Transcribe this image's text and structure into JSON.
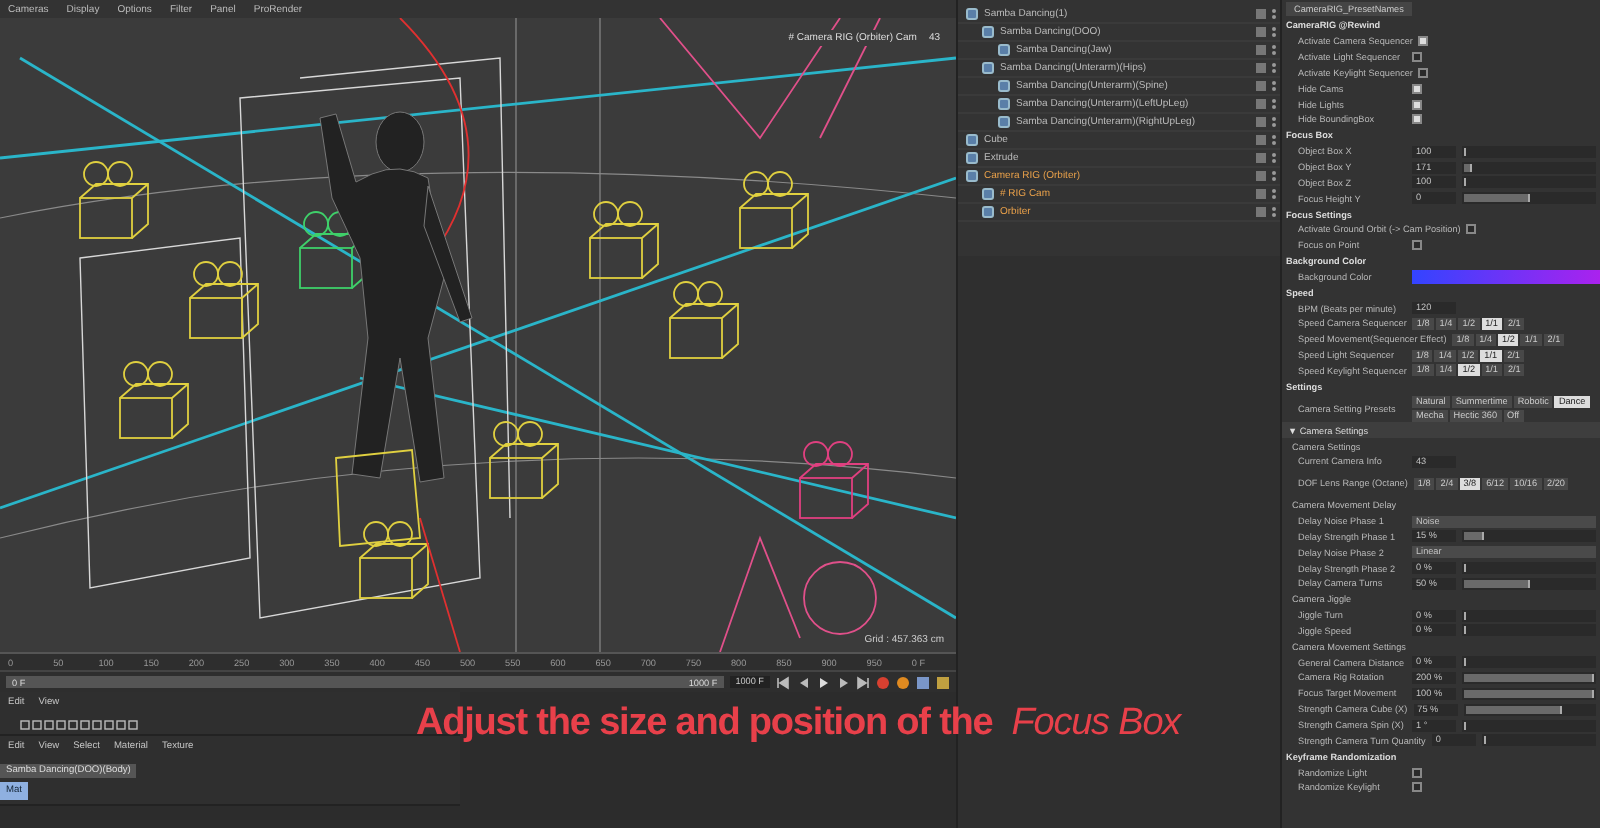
{
  "viewport": {
    "menu": [
      "Cameras",
      "Display",
      "Options",
      "Filter",
      "Panel",
      "ProRender"
    ],
    "camera_label": "# Camera RIG (Orbiter) Cam",
    "camera_number": "43",
    "grid_reading": "Grid : 457.363 cm"
  },
  "objects": [
    {
      "name": "Samba Dancing(1)",
      "selected": false,
      "children": [
        {
          "name": "Samba Dancing(DOO)",
          "selected": false,
          "children": [
            {
              "name": "Samba Dancing(Jaw)",
              "selected": false
            }
          ]
        },
        {
          "name": "Samba Dancing(Unterarm)(Hips)",
          "selected": false,
          "children": [
            {
              "name": "Samba Dancing(Unterarm)(Spine)",
              "selected": false
            },
            {
              "name": "Samba Dancing(Unterarm)(LeftUpLeg)",
              "selected": false
            },
            {
              "name": "Samba Dancing(Unterarm)(RightUpLeg)",
              "selected": false
            }
          ]
        }
      ]
    },
    {
      "name": "Cube",
      "selected": false
    },
    {
      "name": "Extrude",
      "selected": false
    },
    {
      "name": "Camera RIG (Orbiter)",
      "selected": true,
      "children": [
        {
          "name": "# RIG Cam",
          "selected": true
        },
        {
          "name": "Orbiter",
          "selected": true
        }
      ]
    }
  ],
  "attributes": {
    "tab": "CameraRIG_PresetNames",
    "rows": [
      {
        "kind": "header",
        "label": "CameraRIG @Rewind"
      },
      {
        "kind": "check",
        "label": "Activate Camera Sequencer",
        "checked": true
      },
      {
        "kind": "check",
        "label": "Activate Light Sequencer",
        "checked": false
      },
      {
        "kind": "check",
        "label": "Activate Keylight Sequencer",
        "checked": false
      },
      {
        "kind": "check",
        "label": "Hide Cams",
        "checked": true
      },
      {
        "kind": "check",
        "label": "Hide Lights",
        "checked": true
      },
      {
        "kind": "check",
        "label": "Hide BoundingBox",
        "checked": true
      },
      {
        "kind": "header",
        "label": "Focus Box"
      },
      {
        "kind": "number",
        "label": "Object Box X",
        "value": "100",
        "level": 0.02
      },
      {
        "kind": "number",
        "label": "Object Box Y",
        "value": "171",
        "level": 0.06
      },
      {
        "kind": "number",
        "label": "Object Box Z",
        "value": "100",
        "level": 0.02
      },
      {
        "kind": "number",
        "label": "Focus Height Y",
        "value": "0",
        "level": 0.5
      },
      {
        "kind": "header",
        "label": "Focus Settings"
      },
      {
        "kind": "check",
        "label": "Activate Ground Orbit (-> Cam Position)",
        "checked": false
      },
      {
        "kind": "check",
        "label": "Focus on Point",
        "checked": false
      },
      {
        "kind": "header",
        "label": "Background Color"
      },
      {
        "kind": "color",
        "label": "Background Color"
      },
      {
        "kind": "header",
        "label": "Speed"
      },
      {
        "kind": "value",
        "label": "BPM (Beats per minute)",
        "value": "120"
      },
      {
        "kind": "options",
        "label": "Speed Camera Sequencer",
        "options": [
          {
            "label": "1/8",
            "selected": false
          },
          {
            "label": "1/4",
            "selected": false
          },
          {
            "label": "1/2",
            "selected": false
          },
          {
            "label": "1/1",
            "selected": true
          },
          {
            "label": "2/1",
            "selected": false
          }
        ]
      },
      {
        "kind": "options",
        "label": "Speed Movement(Sequencer Effect)",
        "options": [
          {
            "label": "1/8",
            "selected": false
          },
          {
            "label": "1/4",
            "selected": false
          },
          {
            "label": "1/2",
            "selected": true
          },
          {
            "label": "1/1",
            "selected": false
          },
          {
            "label": "2/1",
            "selected": false
          }
        ]
      },
      {
        "kind": "options",
        "label": "Speed Light Sequencer",
        "options": [
          {
            "label": "1/8",
            "selected": false
          },
          {
            "label": "1/4",
            "selected": false
          },
          {
            "label": "1/2",
            "selected": false
          },
          {
            "label": "1/1",
            "selected": true
          },
          {
            "label": "2/1",
            "selected": false
          }
        ]
      },
      {
        "kind": "options",
        "label": "Speed Keylight Sequencer",
        "options": [
          {
            "label": "1/8",
            "selected": false
          },
          {
            "label": "1/4",
            "selected": false
          },
          {
            "label": "1/2",
            "selected": true
          },
          {
            "label": "1/1",
            "selected": false
          },
          {
            "label": "2/1",
            "selected": false
          }
        ]
      },
      {
        "kind": "header",
        "label": "Settings"
      },
      {
        "kind": "options",
        "label": "Camera Setting Presets",
        "options": [
          {
            "label": "Natural",
            "selected": false
          },
          {
            "label": "Summertime",
            "selected": false
          },
          {
            "label": "Robotic",
            "selected": false
          },
          {
            "label": "Dance",
            "selected": true
          },
          {
            "label": "Mecha",
            "selected": false
          },
          {
            "label": "Hectic 360",
            "selected": false
          },
          {
            "label": "Off",
            "selected": false
          }
        ]
      },
      {
        "kind": "group",
        "label": "▼ Camera Settings"
      },
      {
        "kind": "sub",
        "label": "Camera Settings"
      },
      {
        "kind": "value",
        "label": "Current Camera Info",
        "value": "43"
      },
      {
        "kind": "options",
        "label": "DOF Lens Range (Octane)",
        "options": [
          {
            "label": "1/8",
            "selected": false
          },
          {
            "label": "2/4",
            "selected": false
          },
          {
            "label": "3/8",
            "selected": true
          },
          {
            "label": "6/12",
            "selected": false
          },
          {
            "label": "10/16",
            "selected": false
          },
          {
            "label": "2/20",
            "selected": false
          }
        ]
      },
      {
        "kind": "sub",
        "label": "Camera Movement Delay"
      },
      {
        "kind": "choice",
        "label": "Delay Noise Phase 1",
        "value": "Noise"
      },
      {
        "kind": "number",
        "label": "Delay Strength Phase 1",
        "value": "15 %",
        "level": 0.15
      },
      {
        "kind": "choice",
        "label": "Delay Noise Phase 2",
        "value": "Linear"
      },
      {
        "kind": "number",
        "label": "Delay Strength Phase 2",
        "value": "0 %",
        "level": 0
      },
      {
        "kind": "number",
        "label": "Delay Camera Turns",
        "value": "50 %",
        "level": 0.5
      },
      {
        "kind": "sub",
        "label": "Camera Jiggle"
      },
      {
        "kind": "number",
        "label": "Jiggle Turn",
        "value": "0 %",
        "level": 0
      },
      {
        "kind": "number",
        "label": "Jiggle Speed",
        "value": "0 %",
        "level": 0
      },
      {
        "kind": "sub",
        "label": "Camera Movement Settings"
      },
      {
        "kind": "number",
        "label": "General Camera Distance",
        "value": "0 %",
        "level": 0
      },
      {
        "kind": "number",
        "label": "Camera Rig Rotation",
        "value": "200 %",
        "level": 1
      },
      {
        "kind": "number",
        "label": "Focus Target Movement",
        "value": "100 %",
        "level": 1
      },
      {
        "kind": "number",
        "label": "Strength Camera Cube (X)",
        "value": "75 %",
        "level": 0.75
      },
      {
        "kind": "number",
        "label": "Strength Camera Spin (X)",
        "value": "1 °",
        "level": 0.01
      },
      {
        "kind": "number",
        "label": "Strength Camera Turn Quantity",
        "value": "0",
        "level": 0
      },
      {
        "kind": "header",
        "label": "Keyframe Randomization"
      },
      {
        "kind": "check",
        "label": "Randomize Light",
        "checked": false
      },
      {
        "kind": "check",
        "label": "Randomize Keylight",
        "checked": false
      }
    ]
  },
  "timeline": {
    "ticks": [
      "0",
      "50",
      "100",
      "150",
      "200",
      "250",
      "300",
      "350",
      "400",
      "450",
      "500",
      "550",
      "600",
      "650",
      "700",
      "750",
      "800",
      "850",
      "900",
      "950"
    ],
    "end_label": "0 F",
    "start_field": "0 F",
    "end_field": "1000 F",
    "range_field": "1000 F"
  },
  "layers": {
    "menu": [
      "Edit",
      "View"
    ]
  },
  "materials": {
    "menu": [
      "Edit",
      "View",
      "Select",
      "Material",
      "Texture"
    ],
    "tag": "Samba Dancing(DOO)(Body)",
    "material": "Mat"
  },
  "caption": "Adjust the size and position of the *Focus Box*"
}
